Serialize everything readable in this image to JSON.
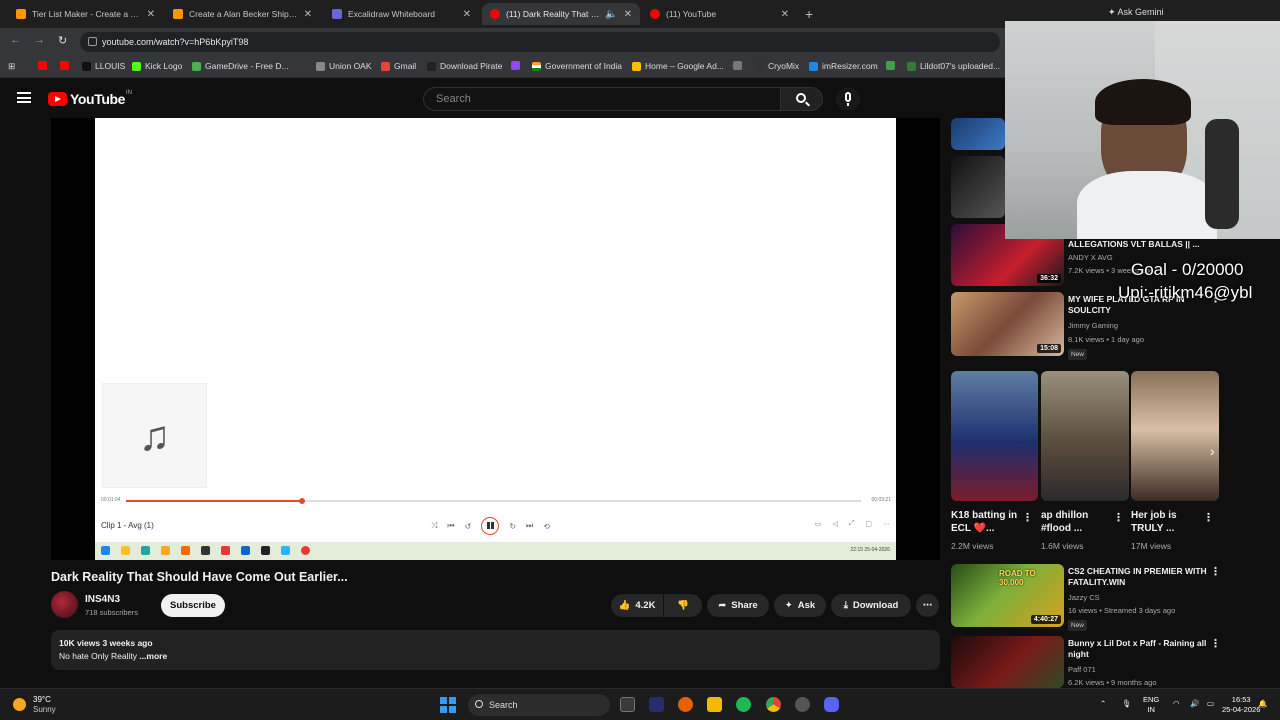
{
  "browser": {
    "tabs": [
      {
        "title": "Tier List Maker - Create a Tier L",
        "active": false
      },
      {
        "title": "Create a Alan Becker Ships Tier",
        "active": false
      },
      {
        "title": "Excalidraw Whiteboard",
        "active": false
      },
      {
        "title": "(11) Dark Reality That Shoul",
        "active": true
      },
      {
        "title": "(11) YouTube",
        "active": false
      }
    ],
    "ask_gemini": "Ask Gemini",
    "url": "youtube.com/watch?v=hP6bKpyiT98",
    "bookmarks": [
      "LLOUIS",
      "Kick Logo",
      "GameDrive - Free D...",
      "Union OAK",
      "Gmail",
      "Download Pirate",
      "Government of India",
      "Home – Google Ad...",
      "CryoMix",
      "imResizer.com",
      "Lildot07's uploaded..."
    ]
  },
  "youtube": {
    "logo_text": "YouTube",
    "country_code": "IN",
    "search_placeholder": "Search"
  },
  "player": {
    "time_current": "00:01:04",
    "time_total": "00:03:21",
    "progress_fraction": 0.24,
    "clip_label": "Clip 1 - Avg (1)",
    "inner_clock": "22:15 25-04-2026"
  },
  "video": {
    "title": "Dark Reality That Should Have Come Out Earlier...",
    "channel": "INS4N3",
    "subscribers": "718 subscribers",
    "subscribe_label": "Subscribe",
    "likes": "4.2K",
    "share_label": "Share",
    "ask_label": "Ask",
    "download_label": "Download",
    "views_date": "10K views  3 weeks ago",
    "description": "No hate Only Reality ",
    "more_label": "...more"
  },
  "sidebar": {
    "rec1": {
      "title": "ALLEGATIONS VLT BALLAS || ...",
      "channel": "ANDY X AVG",
      "meta": "7.2K views • 3 weeks ago",
      "duration": "36:32"
    },
    "rec2": {
      "title": "MY WIFE PLAYED GTA RP IN SOULCITY",
      "channel": "Jimmy Gaming",
      "meta": "8.1K views • 1 day ago",
      "badge": "New",
      "duration": "15:08"
    },
    "shorts": [
      {
        "title": "K18 batting in ECL ❤️...",
        "views": "2.2M views"
      },
      {
        "title": "ap dhillon #flood ...",
        "views": "1.6M views"
      },
      {
        "title": "Her job is TRULY ...",
        "views": "17M views"
      }
    ],
    "rec3": {
      "title": "CS2 CHEATING IN PREMIER WITH FATALITY.WIN",
      "channel": "Jazzy CS",
      "meta": "16 views • Streamed 3 days ago",
      "badge": "New",
      "duration": "4:40:27",
      "thumb_text": "ROAD TO 30,000"
    },
    "rec4": {
      "title": "Bunny x Lil Dot x Paff - Raining all night",
      "channel": "Paff 071",
      "meta": "6.2K views • 9 months ago"
    }
  },
  "overlay": {
    "goal": "Goal - 0/20000",
    "upi": "Upi:-ritikm46@ybl"
  },
  "taskbar": {
    "temperature": "39°C",
    "condition": "Sunny",
    "search_label": "Search",
    "lang": "ENG",
    "region": "IN",
    "time": "16:53",
    "date": "25-04-2026"
  }
}
